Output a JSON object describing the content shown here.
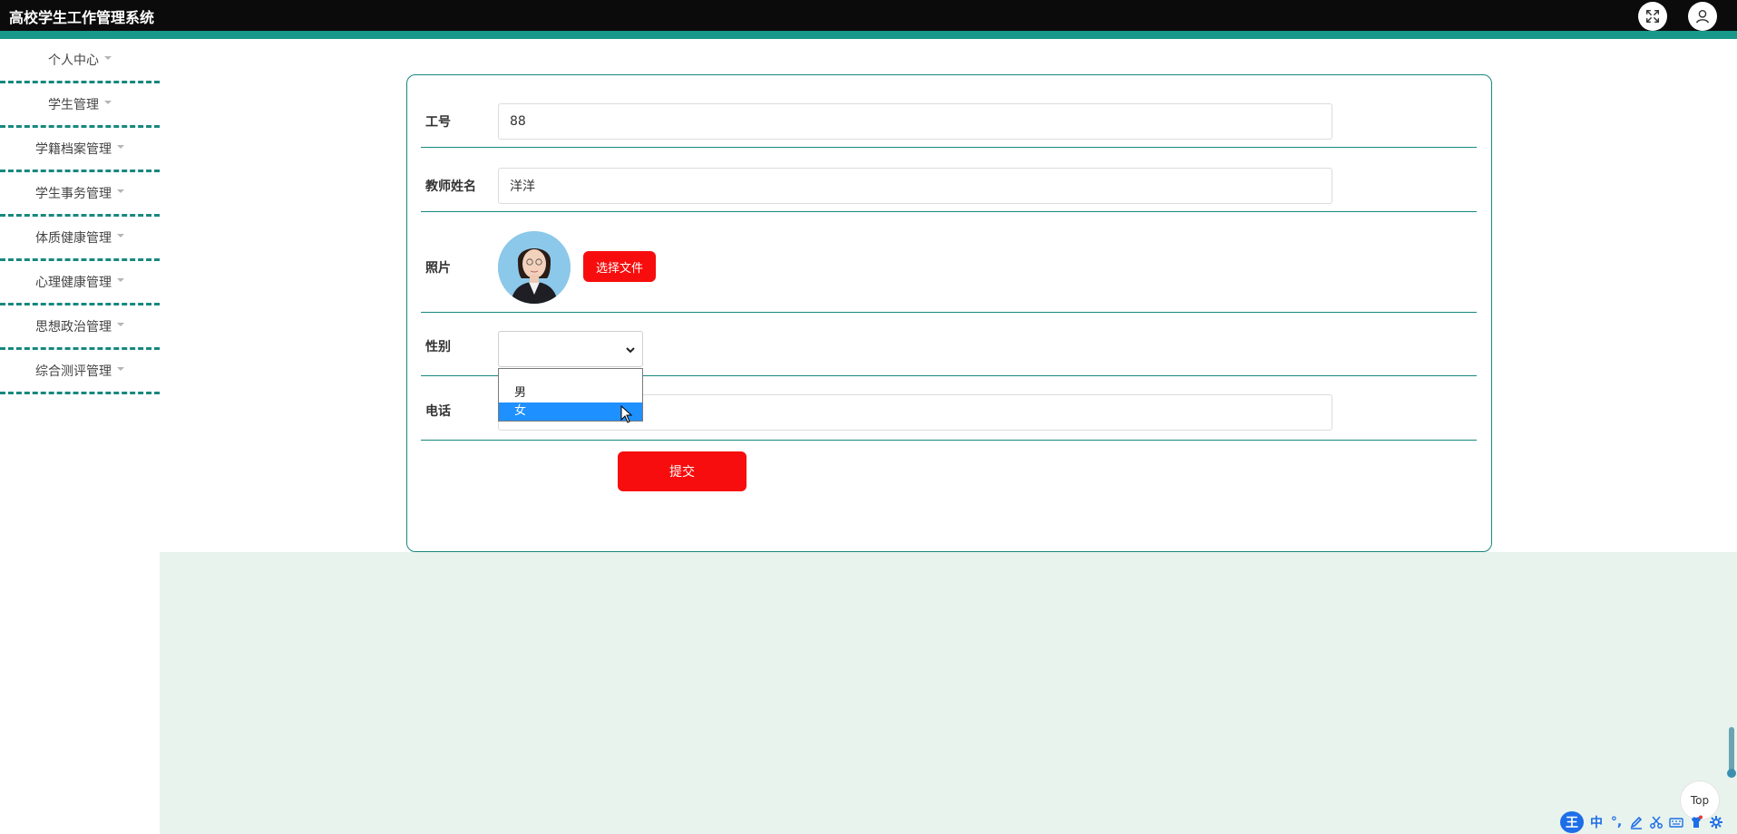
{
  "app": {
    "title": "高校学生工作管理系统"
  },
  "header": {
    "icons": [
      "fullscreen-icon",
      "user-icon"
    ]
  },
  "sidebar": {
    "items": [
      {
        "label": "个人中心"
      },
      {
        "label": "学生管理"
      },
      {
        "label": "学籍档案管理"
      },
      {
        "label": "学生事务管理"
      },
      {
        "label": "体质健康管理"
      },
      {
        "label": "心理健康管理"
      },
      {
        "label": "思想政治管理"
      },
      {
        "label": "综合测评管理"
      }
    ]
  },
  "form": {
    "job_no": {
      "label": "工号",
      "value": "88"
    },
    "teacher_name": {
      "label": "教师姓名",
      "value": "洋洋"
    },
    "photo": {
      "label": "照片",
      "button": "选择文件"
    },
    "gender": {
      "label": "性别",
      "value": "",
      "options": [
        "男",
        "女"
      ],
      "highlighted": "女"
    },
    "phone": {
      "label": "电话",
      "value": ""
    },
    "submit": "提交"
  },
  "top_button": "Top",
  "ime": {
    "logo": "王",
    "mode": "中",
    "punct": "°,"
  },
  "colors": {
    "accent": "#17887f",
    "danger": "#f70d0d",
    "mint": "#e8f3ed",
    "header": "#0b0b0b"
  }
}
